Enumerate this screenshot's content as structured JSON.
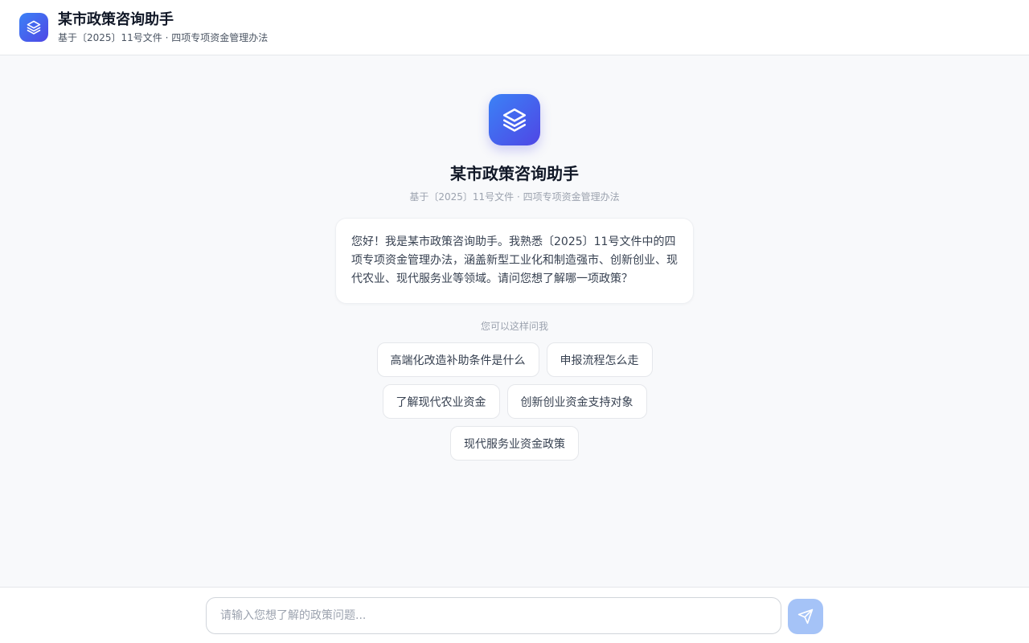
{
  "header": {
    "title": "某市政策咨询助手",
    "subtitle": "基于〔2025〕11号文件 · 四项专项资金管理办法",
    "icon": "layers-icon"
  },
  "welcome": {
    "title": "某市政策咨询助手",
    "subtitle": "基于〔2025〕11号文件 · 四项专项资金管理办法",
    "message": "您好！我是某市政策咨询助手。我熟悉〔2025〕11号文件中的四项专项资金管理办法，涵盖新型工业化和制造强市、创新创业、现代农业、现代服务业等领域。请问您想了解哪一项政策？"
  },
  "suggestions": {
    "hint": "您可以这样问我",
    "items": [
      "高端化改造补助条件是什么",
      "申报流程怎么走",
      "了解现代农业资金",
      "创新创业资金支持对象",
      "现代服务业资金政策"
    ]
  },
  "composer": {
    "placeholder": "请输入您想了解的政策问题...",
    "value": "",
    "send_icon": "send-icon"
  },
  "colors": {
    "accent_start": "#3b82f6",
    "accent_end": "#4f46e5",
    "send_disabled": "#a5c3f7"
  }
}
